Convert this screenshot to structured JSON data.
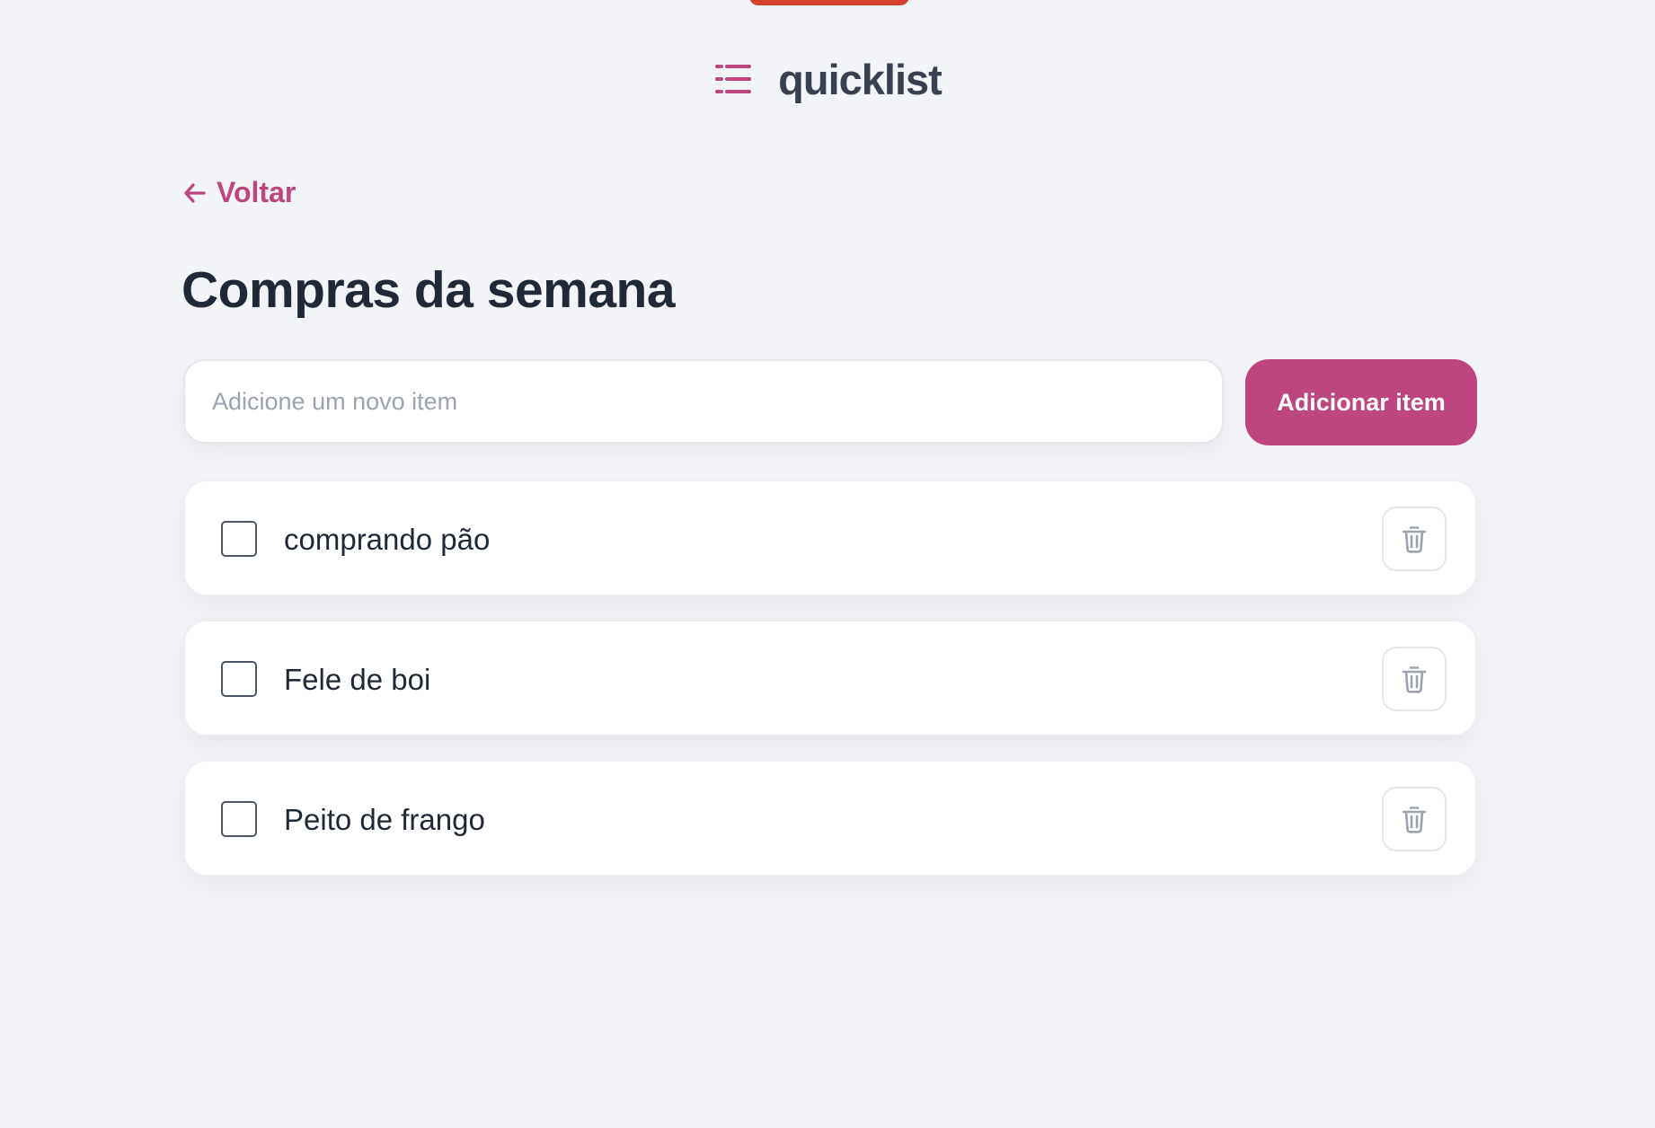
{
  "colors": {
    "background": "#f3f4f8",
    "accent": "#be4680",
    "top_tab": "#d5412e",
    "title_text": "#1f2937",
    "logo_text": "#374151"
  },
  "header": {
    "logo_icon": "list-icon",
    "app_name": "quicklist"
  },
  "navigation": {
    "back_icon": "arrow-left-icon",
    "back_label": "Voltar"
  },
  "page": {
    "title": "Compras da semana"
  },
  "add_form": {
    "input_placeholder": "Adicione um novo item",
    "input_value": "",
    "button_label": "Adicionar item"
  },
  "items": [
    {
      "label": "comprando pão",
      "checked": false,
      "delete_icon": "trash-icon"
    },
    {
      "label": "Fele de boi",
      "checked": false,
      "delete_icon": "trash-icon"
    },
    {
      "label": "Peito de frango",
      "checked": false,
      "delete_icon": "trash-icon"
    }
  ]
}
